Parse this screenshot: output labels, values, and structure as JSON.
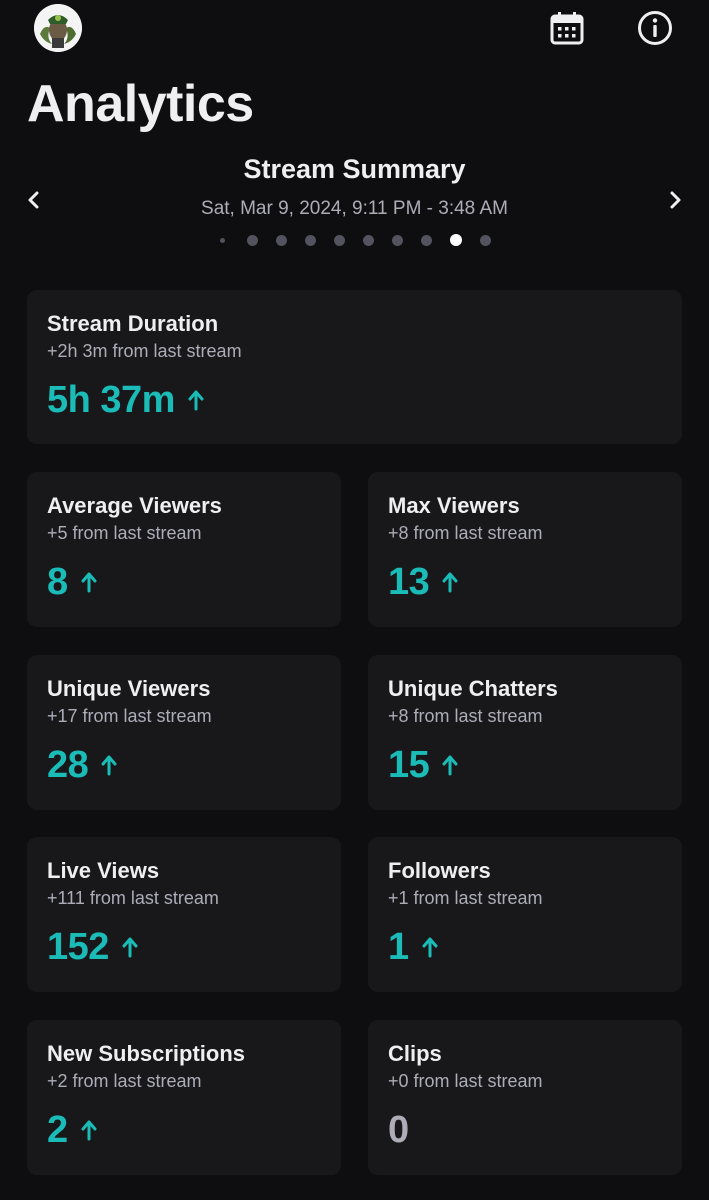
{
  "header": {
    "title": "Analytics"
  },
  "summary": {
    "title": "Stream Summary",
    "date_range": "Sat, Mar 9, 2024, 9:11 PM - 3:48 AM",
    "pages_total": 10,
    "active_page_index": 8
  },
  "colors": {
    "accent": "#1bbcb7",
    "background": "#0e0e10",
    "card": "#18181b",
    "muted_text": "#adadb8"
  },
  "icons": {
    "calendar": "calendar-icon",
    "info": "info-icon",
    "prev": "chevron-left-icon",
    "next": "chevron-right-icon",
    "trend": "arrow-up-icon"
  },
  "stats": {
    "stream_duration": {
      "label": "Stream Duration",
      "delta": "+2h 3m from last stream",
      "value": "5h 37m",
      "trend": "up"
    },
    "average_viewers": {
      "label": "Average Viewers",
      "delta": "+5 from last stream",
      "value": "8",
      "trend": "up"
    },
    "max_viewers": {
      "label": "Max Viewers",
      "delta": "+8 from last stream",
      "value": "13",
      "trend": "up"
    },
    "unique_viewers": {
      "label": "Unique Viewers",
      "delta": "+17 from last stream",
      "value": "28",
      "trend": "up"
    },
    "unique_chatters": {
      "label": "Unique Chatters",
      "delta": "+8 from last stream",
      "value": "15",
      "trend": "up"
    },
    "live_views": {
      "label": "Live Views",
      "delta": "+111 from last stream",
      "value": "152",
      "trend": "up"
    },
    "followers": {
      "label": "Followers",
      "delta": "+1 from last stream",
      "value": "1",
      "trend": "up"
    },
    "new_subscriptions": {
      "label": "New Subscriptions",
      "delta": "+2 from last stream",
      "value": "2",
      "trend": "up"
    },
    "clips": {
      "label": "Clips",
      "delta": "+0 from last stream",
      "value": "0",
      "trend": "none"
    }
  }
}
